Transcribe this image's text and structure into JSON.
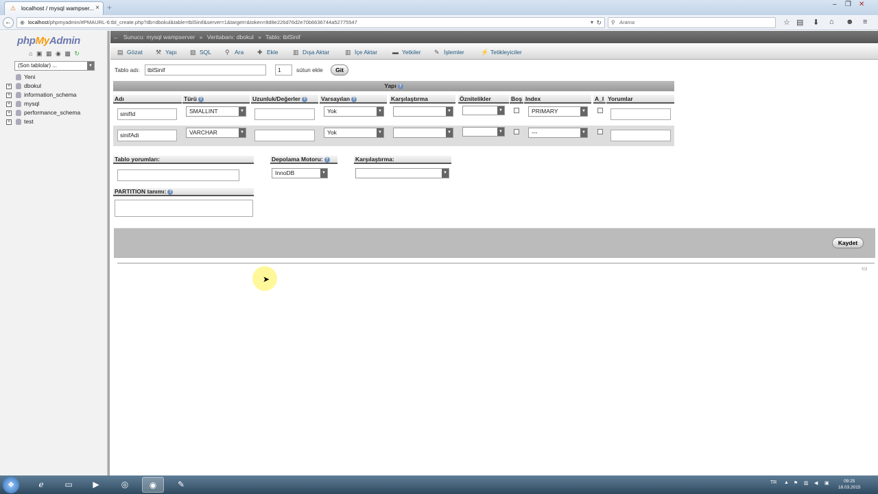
{
  "browser": {
    "tab_title": "localhost / mysql wampser...",
    "tab_close": "×",
    "new_tab": "+",
    "url_host": "localhost",
    "url_rest": "/phpmyadmin/#PMAURL-6:tbl_create.php?db=dbokul&table=tblSinif&server=1&target=&token=8d8e226d76d2e70b6636744a52775547",
    "search_placeholder": "Arama"
  },
  "sidebar": {
    "logo_php": "php",
    "logo_my": "My",
    "logo_admin": "Admin",
    "recent_tables": "(Son tablolar) ...",
    "tree": [
      {
        "label": "Yeni"
      },
      {
        "label": "dbokul"
      },
      {
        "label": "information_schema"
      },
      {
        "label": "mysql"
      },
      {
        "label": "performance_schema"
      },
      {
        "label": "test"
      }
    ]
  },
  "breadcrumb": {
    "server": "Sunucu: mysql wampserver",
    "database": "Veritabanı: dbokul",
    "table": "Tablo: tblSinif",
    "sep": "»"
  },
  "menu": {
    "items": [
      {
        "label": "Gözat",
        "icon": "browse-icon"
      },
      {
        "label": "Yapı",
        "icon": "structure-icon"
      },
      {
        "label": "SQL",
        "icon": "sql-icon"
      },
      {
        "label": "Ara",
        "icon": "search-icon"
      },
      {
        "label": "Ekle",
        "icon": "insert-icon"
      },
      {
        "label": "Dışa Aktar",
        "icon": "export-icon"
      },
      {
        "label": "İçe Aktar",
        "icon": "import-icon"
      },
      {
        "label": "Yetkiler",
        "icon": "privileges-icon"
      },
      {
        "label": "İşlemler",
        "icon": "operations-icon"
      },
      {
        "label": "Tetikleyiciler",
        "icon": "triggers-icon"
      }
    ]
  },
  "form": {
    "table_name_label": "Tablo adı:",
    "table_name_value": "tblSinif",
    "add_columns_count": "1",
    "add_columns_label": "sütun ekle",
    "go_button": "Git",
    "structure_header": "Yapı",
    "columns": {
      "name": "Adı",
      "type": "Türü",
      "length": "Uzunluk/Değerler",
      "default": "Varsayılan",
      "collation": "Karşılaştırma",
      "attributes": "Öznitelikler",
      "null": "Boş",
      "index": "Index",
      "ai": "A_I",
      "comments": "Yorumlar"
    },
    "rows": [
      {
        "name": "sinifId",
        "type": "SMALLINT",
        "length": "",
        "default": "Yok",
        "collation": "",
        "attributes": "",
        "index": "PRIMARY",
        "comments": ""
      },
      {
        "name": "sinifAdi",
        "type": "VARCHAR",
        "length": "",
        "default": "Yok",
        "collation": "",
        "attributes": "",
        "index": "---",
        "comments": ""
      }
    ],
    "table_comments_label": "Tablo yorumları:",
    "storage_engine_label": "Depolama Motoru:",
    "storage_engine_value": "InnoDB",
    "collation_label": "Karşılaştırma:",
    "partition_label": "PARTITION tanımı:",
    "save_button": "Kaydet"
  },
  "taskbar": {
    "lang": "TR",
    "time": "09:25",
    "date": "18.03.2015"
  }
}
